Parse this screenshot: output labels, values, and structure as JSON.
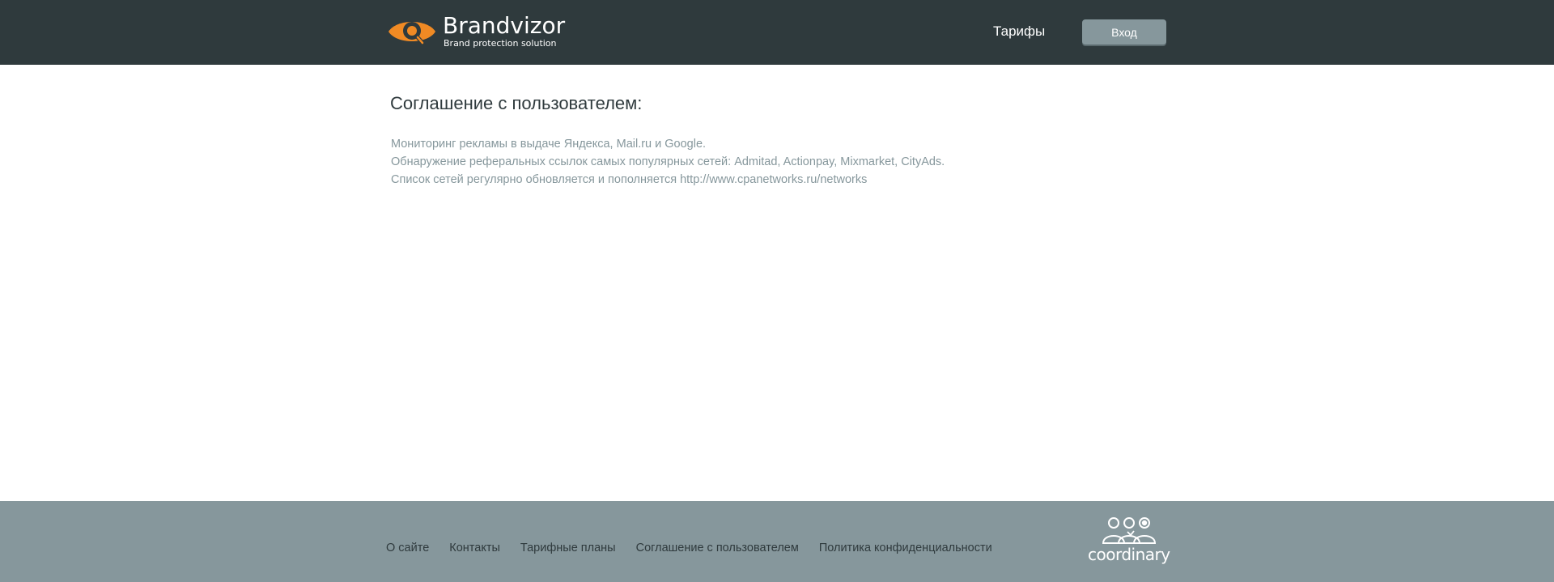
{
  "header": {
    "logo": {
      "name": "Brandvizor",
      "tagline": "Brand protection solution",
      "icon": "eye-magnifier-icon",
      "accent_color": "#f08a24"
    },
    "nav": {
      "tariffs_label": "Тарифы"
    },
    "login_label": "Вход"
  },
  "main": {
    "title": "Соглашение с пользователем:",
    "lines": [
      "Мониторинг рекламы в выдаче Яндекса, Mail.ru и Google.",
      "Обнаружение реферальных ссылок самых популярных сетей: Admitad, Actionpay, Mixmarket, CityAds.",
      "Список сетей регулярно обновляется и пополняется http://www.cpanetworks.ru/networks"
    ]
  },
  "footer": {
    "links": [
      "О сайте",
      "Контакты",
      "Тарифные планы",
      "Соглашение с пользователем",
      "Политика конфиденциальности"
    ],
    "partner": {
      "name": "coordinary",
      "icon": "people-group-icon"
    }
  },
  "colors": {
    "header_bg": "#2f3a3d",
    "footer_bg": "#86979c",
    "text_muted": "#86979c",
    "text_dark": "#2f3a3d",
    "accent": "#f08a24"
  }
}
